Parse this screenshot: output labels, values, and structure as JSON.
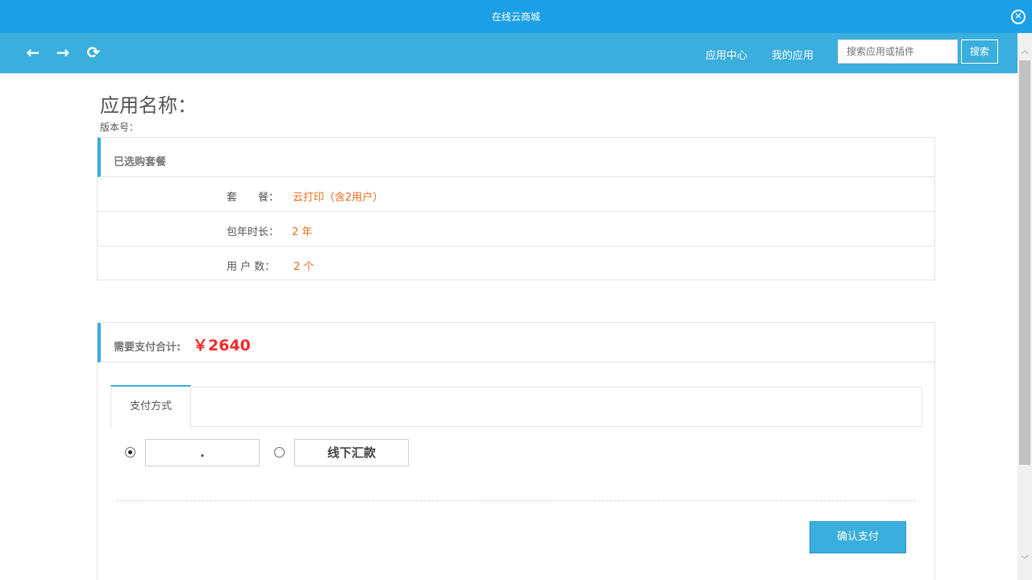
{
  "window": {
    "title": "在线云商城",
    "close_icon": "close-circle-icon"
  },
  "nav": {
    "back_icon": "←",
    "forward_icon": "→",
    "refresh_icon": "⟳",
    "links": [
      "应用中心",
      "我的应用"
    ],
    "search_placeholder": "搜索应用或插件",
    "search_button": "搜索"
  },
  "app": {
    "name_label": "应用名称：",
    "version_label": "版本号："
  },
  "selected_package": {
    "heading": "已选购套餐",
    "rows": [
      {
        "key": "套　　餐：",
        "value": "云打印（含2用户）"
      },
      {
        "key": "包年时长：",
        "value": "2 年"
      },
      {
        "key": "用 户 数：",
        "value": "2 个"
      }
    ]
  },
  "payment": {
    "total_label": "需要支付合计:",
    "total_value": "￥2640",
    "tab_label": "支付方式",
    "options": [
      {
        "label": ".",
        "selected": true
      },
      {
        "label": "线下汇款",
        "selected": false
      }
    ],
    "confirm_button": "确认支付"
  },
  "colors": {
    "titlebar": "#1ba0e6",
    "navbar": "#3aaedc",
    "accent": "#3aaedc",
    "highlight_orange": "#f06a1a",
    "price_red": "#f32a2a"
  }
}
